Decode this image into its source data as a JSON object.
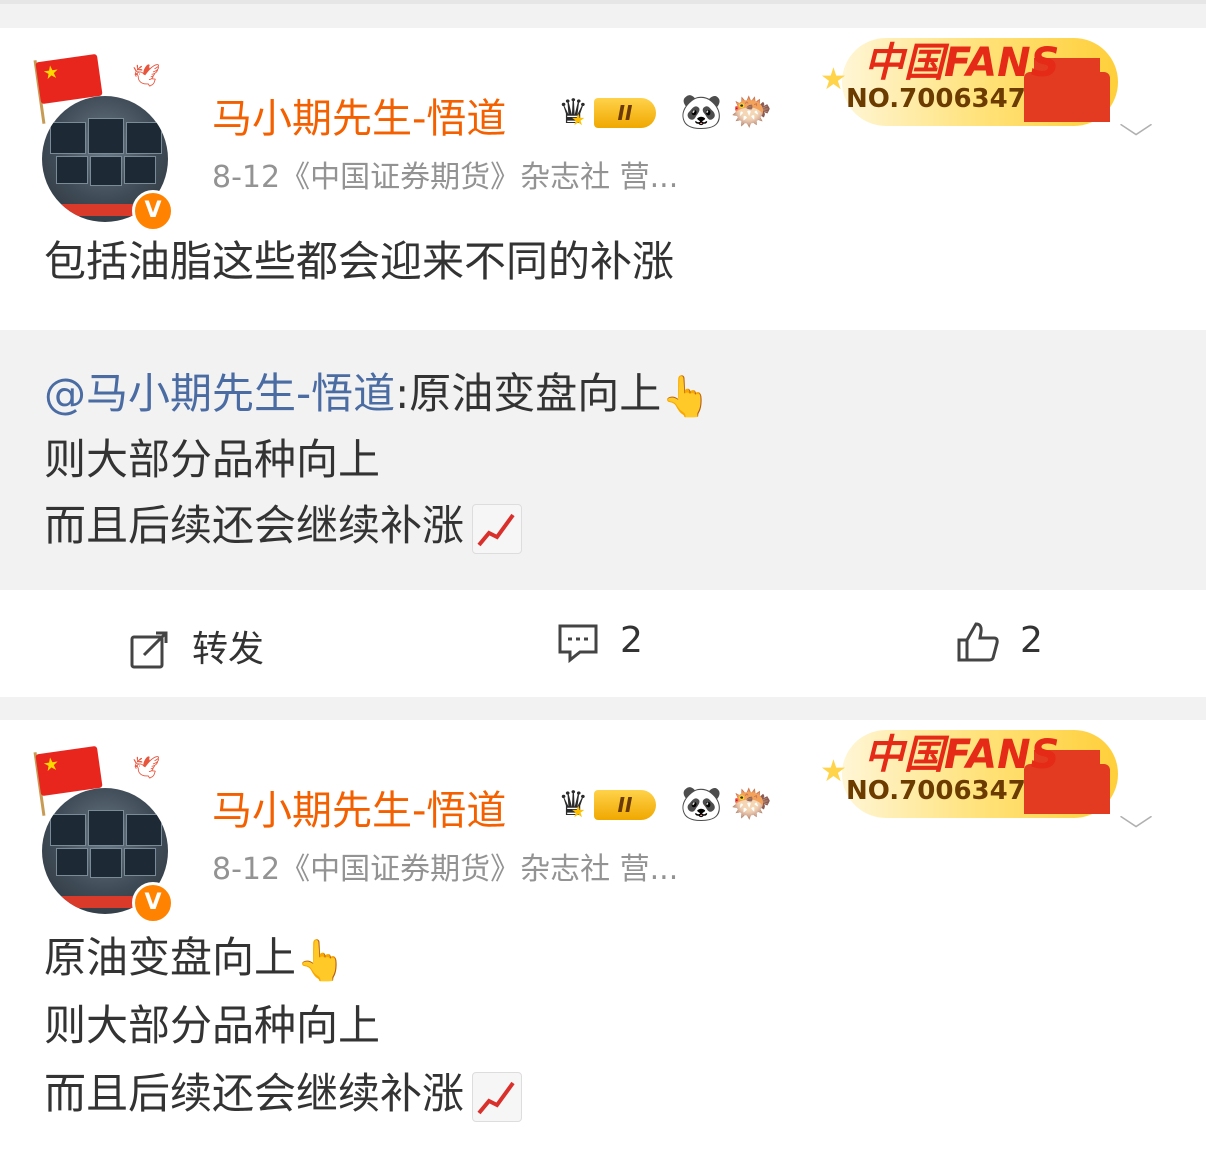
{
  "posts": [
    {
      "username": "马小期先生-悟道",
      "level": "II",
      "meta": "8-12《中国证券期货》杂志社 营...",
      "fans_title": "中国FANS",
      "fans_no": "NO.7006347",
      "text_lines": [
        "包括油脂这些都会迎来不同的补涨"
      ],
      "repost": {
        "at_user": "@马小期先生-悟道",
        "line1": ":原油变盘向上",
        "line2": "则大部分品种向上",
        "line3": "而且后续还会继续补涨"
      },
      "actions": {
        "repost_label": "转发",
        "comments": "2",
        "likes": "2"
      }
    },
    {
      "username": "马小期先生-悟道",
      "level": "II",
      "meta": "8-12《中国证券期货》杂志社 营...",
      "fans_title": "中国FANS",
      "fans_no": "NO.7006347",
      "text_lines": [
        "原油变盘向上",
        "则大部分品种向上",
        "而且后续还会继续补涨"
      ]
    }
  ],
  "icons": {
    "avatar_badge": "V",
    "point_emoji": "👆",
    "chart_emoji": "chart-increasing",
    "more": "chevron-down"
  },
  "colors": {
    "username": "#f46000",
    "mention": "#4a6ca3",
    "meta": "#939393",
    "verified": "#ff8200"
  }
}
